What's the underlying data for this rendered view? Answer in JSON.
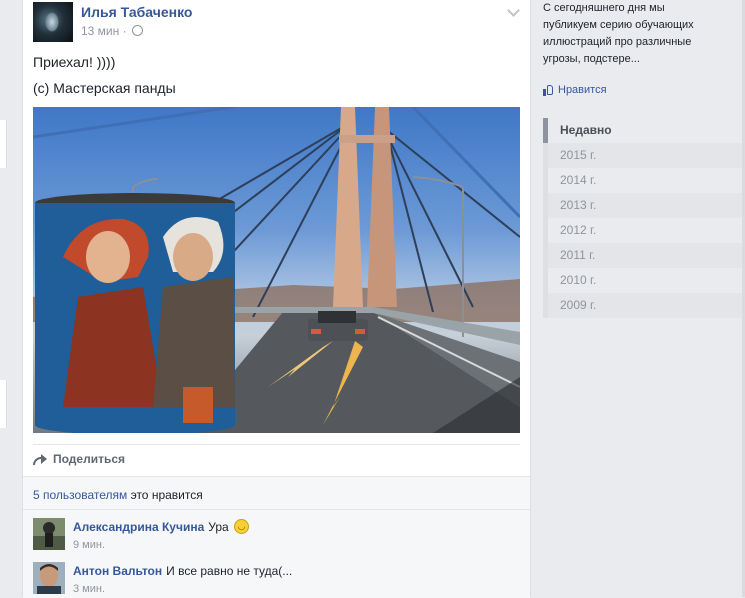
{
  "post": {
    "author": "Илья Табаченко",
    "time": "13 мин",
    "separator": "·",
    "text1": "Приехал! ))))",
    "text2": "(с) Мастерская панды",
    "share_label": "Поделиться",
    "likes_count_link": "5 пользователям",
    "likes_suffix": " это нравится"
  },
  "comments": [
    {
      "name": "Александрина Кучина",
      "text": "Ура",
      "emoji": "smiley-icon",
      "time": "9 мин."
    },
    {
      "name": "Антон Вальтон",
      "text": "И все равно не туда(...",
      "time": "3 мин."
    }
  ],
  "sidebar": {
    "snippet": "С сегодняшнего дня мы публикуем серию обучающих иллюстраций про различные угрозы, подстере...",
    "like_label": "Нравится",
    "timeline": [
      "Недавно",
      "2015 г.",
      "2014 г.",
      "2013 г.",
      "2012 г.",
      "2011 г.",
      "2010 г.",
      "2009 г."
    ]
  },
  "colors": {
    "link": "#365899",
    "muted": "#90949c",
    "background": "#e9ebee"
  }
}
